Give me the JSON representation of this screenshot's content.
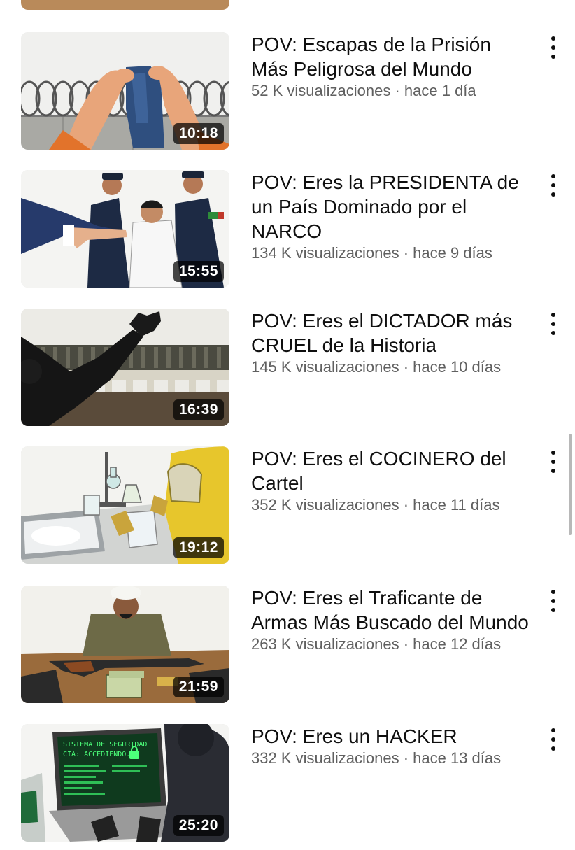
{
  "videos": [
    {
      "title": "POV: Escapas de la Prisión Más Peligrosa del Mundo",
      "views": "52 K visualizaciones",
      "age": "hace 1 día",
      "duration": "10:18"
    },
    {
      "title": "POV: Eres la PRESIDENTA de un País Dominado por el NARCO",
      "views": "134 K visualizaciones",
      "age": "hace 9 días",
      "duration": "15:55"
    },
    {
      "title": "POV: Eres el DICTADOR más CRUEL de la Historia",
      "views": "145 K visualizaciones",
      "age": "hace 10 días",
      "duration": "16:39"
    },
    {
      "title": "POV: Eres el COCINERO del Cartel",
      "views": "352 K visualizaciones",
      "age": "hace 11 días",
      "duration": "19:12"
    },
    {
      "title": "POV: Eres el Traficante de Armas Más Buscado del Mundo",
      "views": "263 K visualizaciones",
      "age": "hace 12 días",
      "duration": "21:59"
    },
    {
      "title": "POV: Eres un HACKER",
      "views": "332 K visualizaciones",
      "age": "hace 13 días",
      "duration": "25:20"
    }
  ],
  "meta_separator": " · ",
  "thumbnail_text": {
    "hacker_screen_line1": "SISTEMA DE SEGURIDAD",
    "hacker_screen_line2": "CIA: ACCEDIENDO..."
  },
  "icons": {
    "more": "vertical-ellipsis-icon"
  }
}
